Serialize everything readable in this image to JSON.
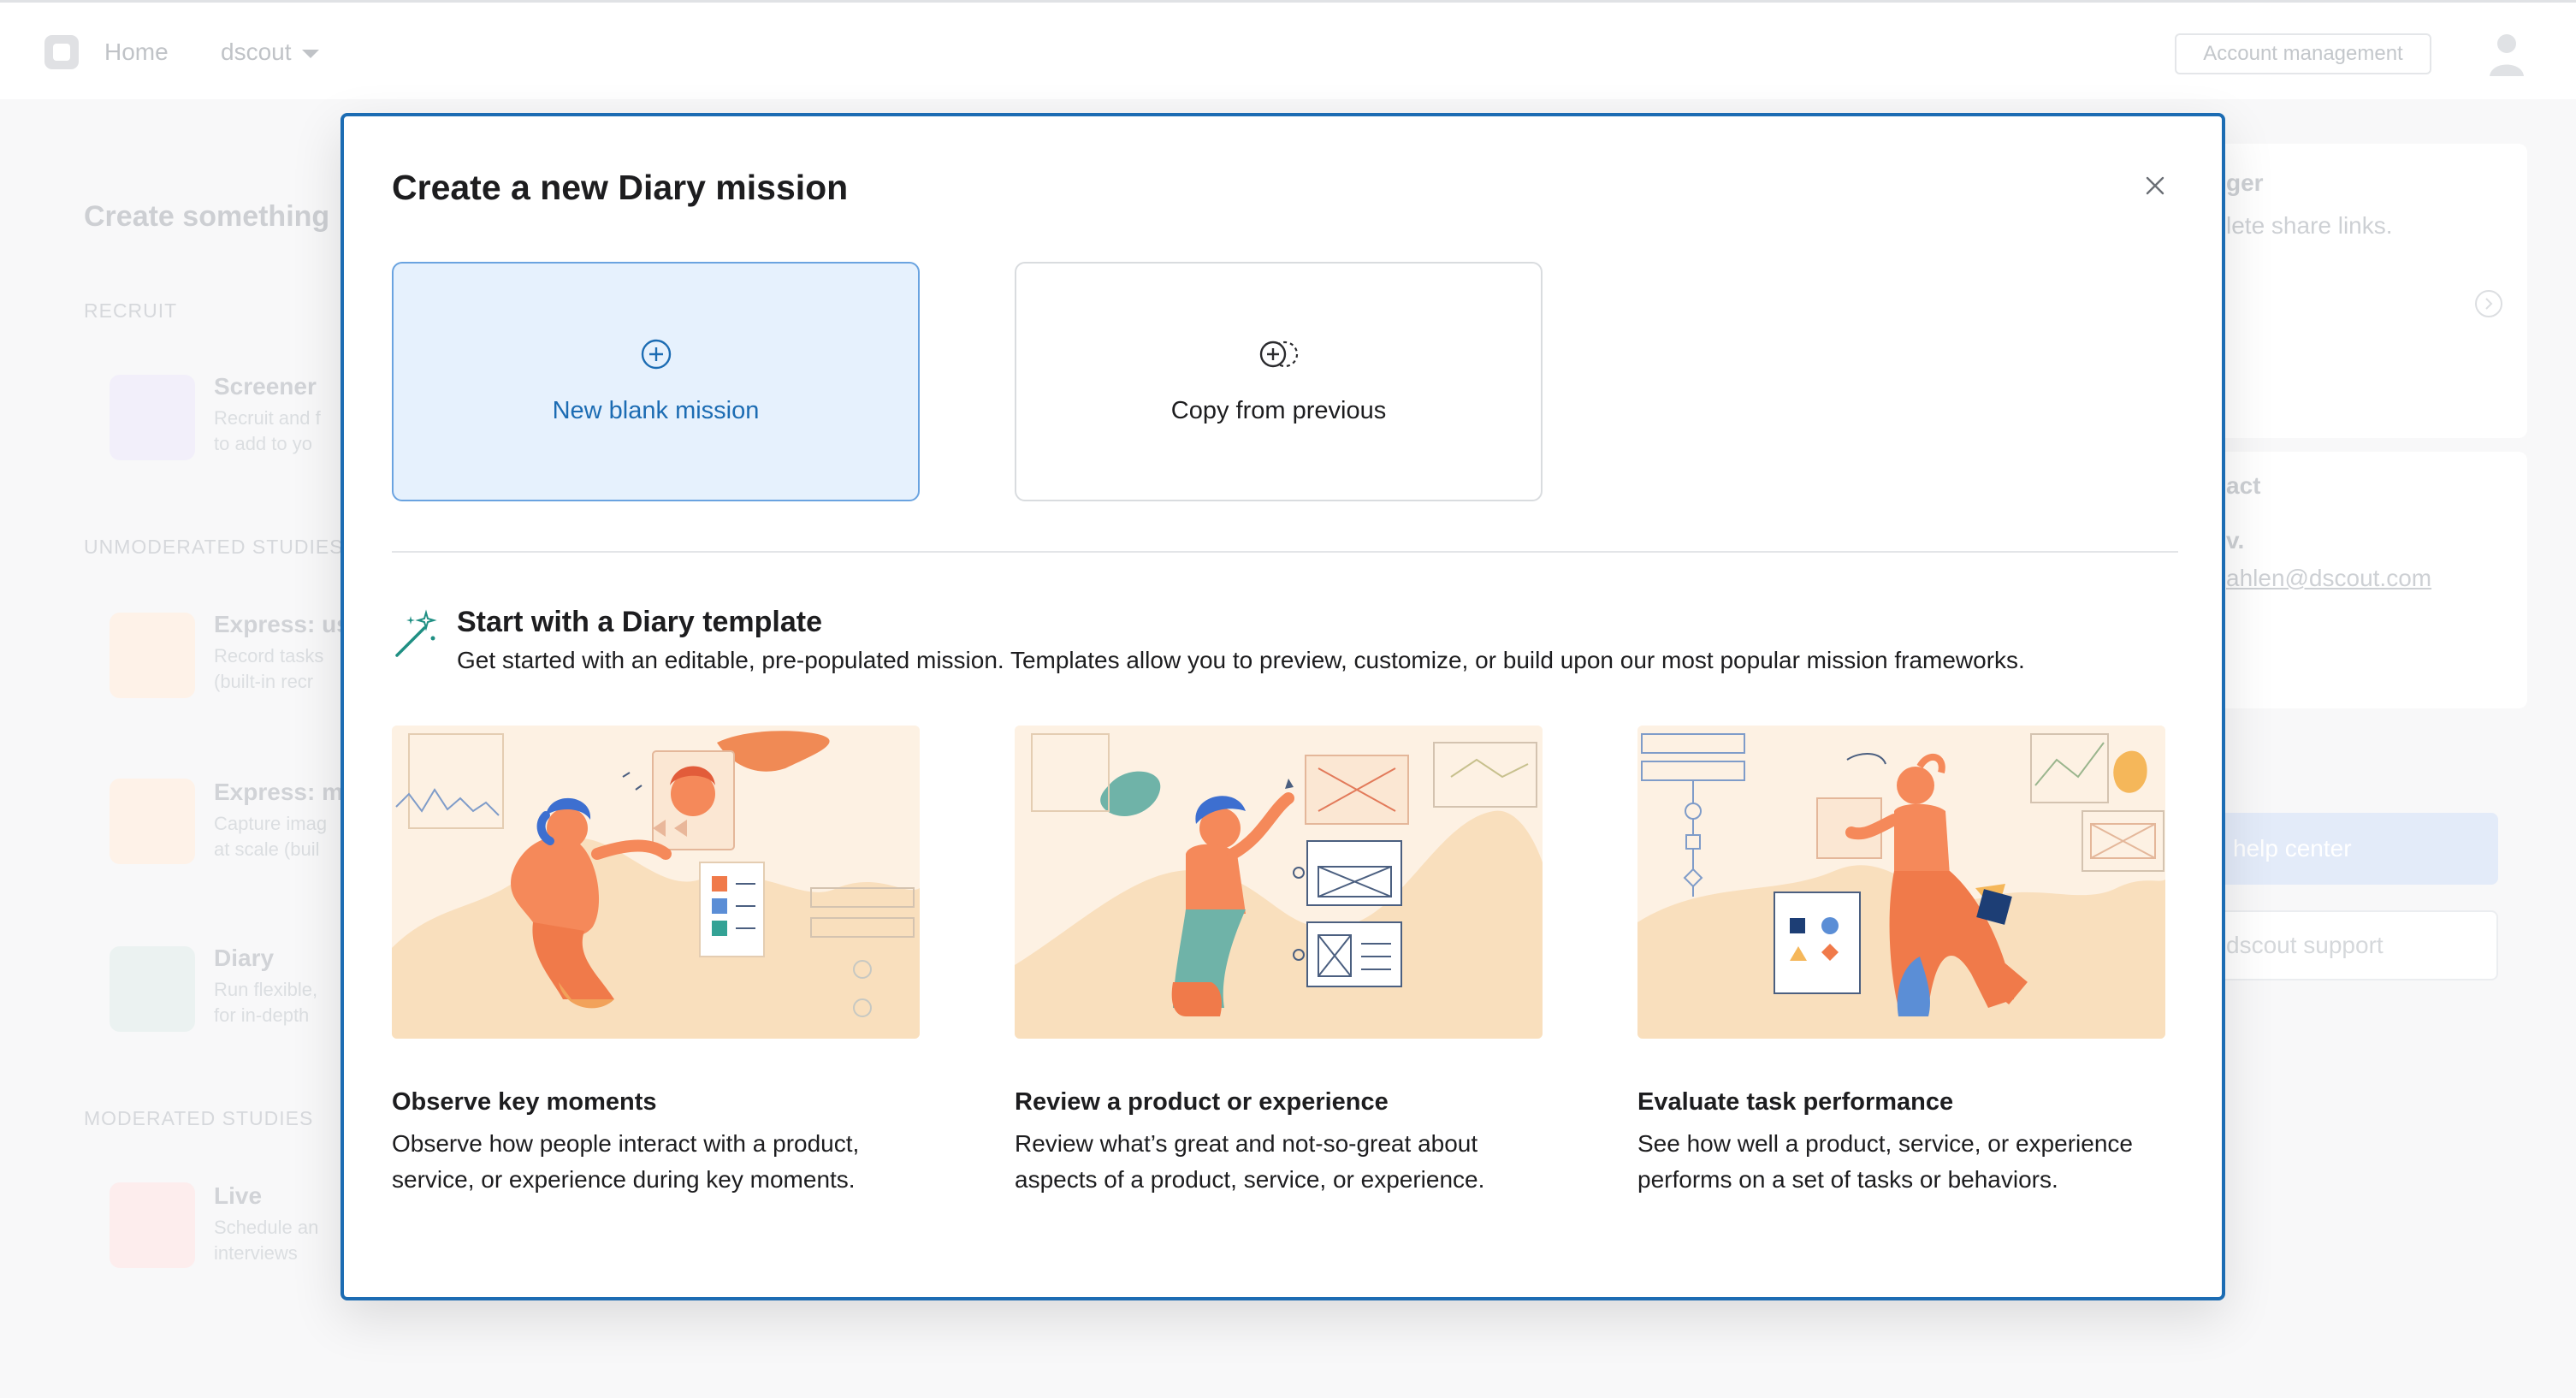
{
  "topbar": {
    "nav_home": "Home",
    "nav_dscout": "dscout",
    "account_button": "Account management"
  },
  "background": {
    "title": "Create something",
    "sections": {
      "recruit": "RECRUIT",
      "unmoderated": "UNMODERATED STUDIES",
      "moderated": "MODERATED STUDIES"
    },
    "items": [
      {
        "title": "Screener",
        "sub1": "Recruit and f",
        "sub2": "to add to yo",
        "icon": "users-icon",
        "color": "#e2ddf3"
      },
      {
        "title": "Express: us",
        "sub1": "Record tasks",
        "sub2": "(built-in recr",
        "icon": "lightning-icon",
        "color": "#fbe2cc"
      },
      {
        "title": "Express: m",
        "sub1": "Capture imag",
        "sub2": "at scale (buil",
        "icon": "lightning-icon",
        "color": "#fbe2cc"
      },
      {
        "title": "Diary",
        "sub1": "Run flexible,",
        "sub2": "for in-depth",
        "icon": "diary-icon",
        "color": "#d6e5e2"
      },
      {
        "title": "Live",
        "sub1": "Schedule an",
        "sub2": "interviews",
        "icon": "face-scan-icon",
        "color": "#f9d6d8"
      }
    ],
    "right": {
      "card1_title": "ger",
      "card1_sub": "lete share links.",
      "card2_title": "act",
      "card2_name": "v.",
      "card2_email": "ahlen@dscout.com",
      "help_button": "help center",
      "support_button": "dscout support"
    }
  },
  "modal": {
    "title": "Create a new Diary mission",
    "options": [
      {
        "label": "New blank mission",
        "icon": "plus-circle-icon",
        "selected": true
      },
      {
        "label": "Copy from previous",
        "icon": "copy-circle-icon",
        "selected": false
      }
    ],
    "template_heading": "Start with a Diary template",
    "template_sub": "Get started with an editable, pre-populated mission. Templates allow you to preview, customize, or build upon our most popular mission frameworks.",
    "templates": [
      {
        "title": "Observe key moments",
        "desc": "Observe how people interact with a product, service, or experience during key moments."
      },
      {
        "title": "Review a product or experience",
        "desc": "Review what’s great and not-so-great about aspects of a product, service, or experience."
      },
      {
        "title": "Evaluate task performance",
        "desc": "See how well a product, service, or experience performs on a set of tasks or behaviors."
      }
    ]
  },
  "colors": {
    "accent": "#1c6cb3",
    "selected_bg": "#e6f1fd",
    "illustration_bg": "#fdf1e3",
    "figure_orange": "#f07a4a",
    "figure_blue": "#5b8ed6"
  }
}
